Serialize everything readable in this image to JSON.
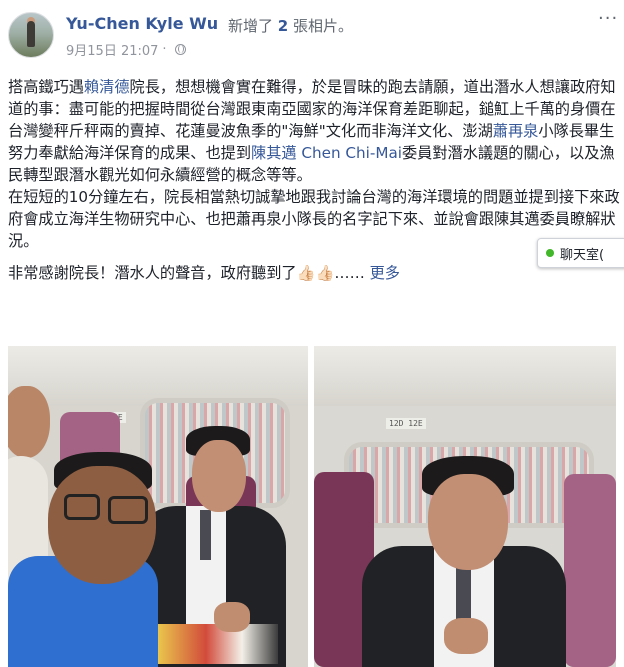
{
  "post": {
    "author": "Yu-Chen Kyle Wu",
    "action_prefix": "新增了",
    "action_count": "2",
    "action_suffix": "張相片。",
    "date": "9月15日 21:07",
    "dot": "·",
    "menu_glyph": "···",
    "text": {
      "p1_a": "搭高鐵巧遇",
      "p1_link": "賴清德",
      "p1_b": "院長，想想機會實在難得，於是冒昧的跑去請願，道出潛水人想讓政府知道的事：盡可能的把握時間從台灣跟東南亞國家的海洋保育差距聊起，鎚魟上千萬的身價在台灣變秤斤秤兩的賣掉、花蓮曼波魚季的\"海鮮\"文化而非海洋文化、澎湖",
      "p1_link2": "蕭再泉",
      "p1_c": "小隊長畢生努力奉獻給海洋保育的成果、也提到",
      "p1_link3": "陳其邁 Chen Chi-Mai",
      "p1_d": "委員對潛水議題的關心，以及漁民轉型跟潛水觀光如何永續經營的概念等等。",
      "p2": "在短短的10分鐘左右，院長相當熱切誠摯地跟我討論台灣的海洋環境的問題並提到接下來政府會成立海洋生物研究中心、也把蕭再泉小隊長的名字記下來、並說會跟陳其邁委員瞭解狀況。",
      "p3": "非常感謝院長！潛水人的聲音，政府聽到了👍🏻👍🏻……",
      "see_more": "更多"
    }
  },
  "chat": {
    "label": "聊天室(",
    "status_color": "#42b72a"
  },
  "photos": {
    "photo1": {
      "seat_label": "12D 12E"
    },
    "photo2": {
      "seat_label": "12D 12E"
    }
  },
  "colors": {
    "link": "#365899",
    "text": "#1d2129",
    "muted": "#90949c"
  },
  "icons": [
    "globe-icon",
    "more-options-icon",
    "online-dot-icon"
  ]
}
